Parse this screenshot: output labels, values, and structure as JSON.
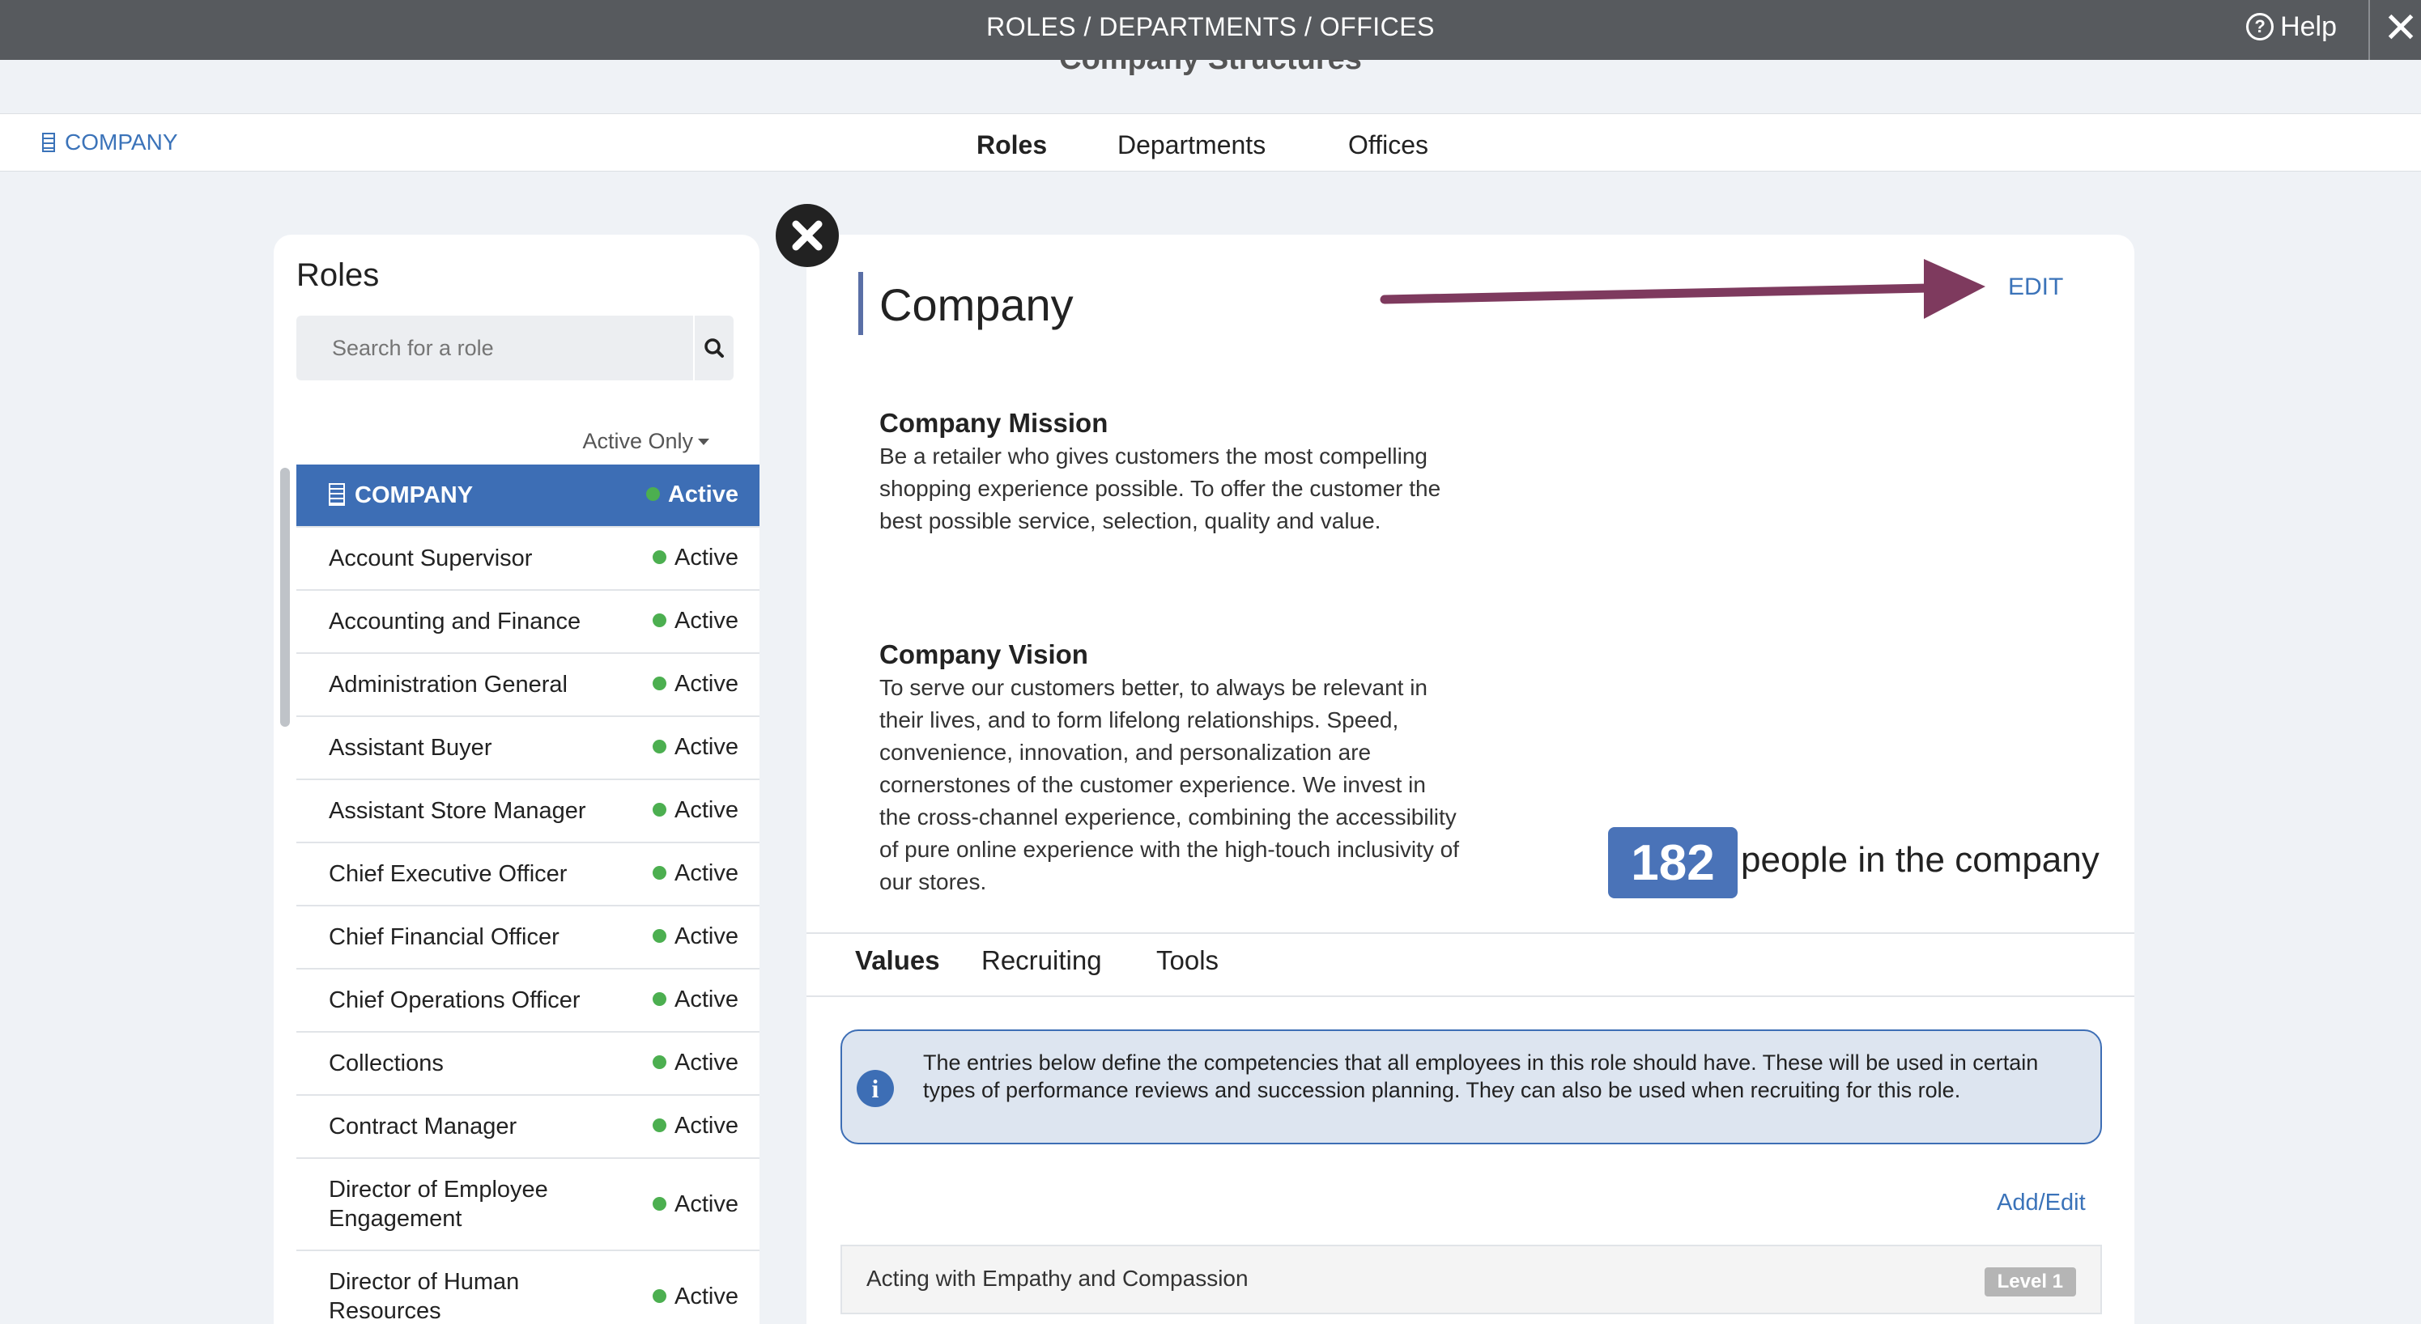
{
  "window": {
    "title": "ROLES / DEPARTMENTS / OFFICES",
    "help_label": "Help",
    "close_symbol": "✕"
  },
  "page_heading": "Company Structures",
  "nav": {
    "company_link": "COMPANY",
    "tabs": [
      {
        "label": "Roles",
        "active": true
      },
      {
        "label": "Departments",
        "active": false
      },
      {
        "label": "Offices",
        "active": false
      }
    ]
  },
  "sidebar": {
    "title": "Roles",
    "search_placeholder": "Search for a role",
    "filter_label": "Active Only",
    "roles": [
      {
        "name": "COMPANY",
        "status": "Active",
        "selected": true
      },
      {
        "name": "Account Supervisor",
        "status": "Active"
      },
      {
        "name": "Accounting and Finance",
        "status": "Active"
      },
      {
        "name": "Administration General",
        "status": "Active"
      },
      {
        "name": "Assistant Buyer",
        "status": "Active"
      },
      {
        "name": "Assistant Store Manager",
        "status": "Active"
      },
      {
        "name": "Chief Executive Officer",
        "status": "Active"
      },
      {
        "name": "Chief Financial Officer",
        "status": "Active"
      },
      {
        "name": "Chief Operations Officer",
        "status": "Active"
      },
      {
        "name": "Collections",
        "status": "Active"
      },
      {
        "name": "Contract Manager",
        "status": "Active"
      },
      {
        "name": "Director of Employee Engagement",
        "status": "Active",
        "tall": true
      },
      {
        "name": "Director of Human Resources",
        "status": "Active",
        "tall": true
      }
    ]
  },
  "detail": {
    "title": "Company",
    "edit_label": "EDIT",
    "mission_heading": "Company Mission",
    "mission_text": "Be a retailer who gives customers the most compelling shopping experience possible. To offer the customer the best possible service, selection, quality and value.",
    "vision_heading": "Company Vision",
    "vision_text": "To serve our customers better, to always be relevant in their lives, and to form lifelong relationships. Speed, convenience, innovation, and personalization are cornerstones of the customer experience. We invest in the cross-channel experience, combining the accessibility of pure online experience with the high-touch inclusivity of our stores.",
    "people_count": "182",
    "people_label": "people in the company",
    "tabs": [
      {
        "label": "Values",
        "active": true
      },
      {
        "label": "Recruiting",
        "active": false
      },
      {
        "label": "Tools",
        "active": false
      }
    ],
    "info_text": "The entries below define the competencies that all employees in this role should have. These will be used in certain types of performance reviews and succession planning. They can also be used when recruiting for this role.",
    "add_edit_label": "Add/Edit",
    "values": [
      {
        "name": "Acting with Empathy and Compassion",
        "level": "Level 1"
      }
    ]
  },
  "colors": {
    "topbar": "#575a5e",
    "accent_blue": "#3d6eb5",
    "link_blue": "#3b73b9",
    "active_green": "#4caf50",
    "annotation_arrow": "#7e3a5e"
  },
  "icons": [
    "help-icon",
    "close-icon",
    "building-icon",
    "search-icon",
    "caret-down-icon",
    "close-circle-icon",
    "info-icon",
    "arrow-annotation"
  ]
}
